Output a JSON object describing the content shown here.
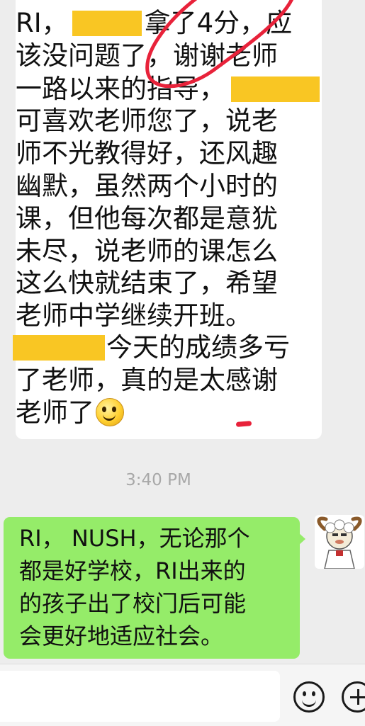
{
  "incoming_message": {
    "lines": [
      {
        "segments": [
          {
            "type": "text",
            "text": "RI，"
          },
          {
            "type": "redacted"
          },
          {
            "type": "text",
            "text": "拿了4分，应"
          }
        ]
      },
      {
        "segments": [
          {
            "type": "text",
            "text": "该没问题了，谢谢老师"
          }
        ]
      },
      {
        "segments": [
          {
            "type": "text",
            "text": "一路以来的指导，"
          },
          {
            "type": "redacted"
          }
        ]
      },
      {
        "segments": [
          {
            "type": "text",
            "text": "可喜欢老师您了，说老"
          }
        ]
      },
      {
        "segments": [
          {
            "type": "text",
            "text": "师不光教得好，还风趣"
          }
        ]
      },
      {
        "segments": [
          {
            "type": "text",
            "text": "幽默，虽然两个小时的"
          }
        ]
      },
      {
        "segments": [
          {
            "type": "text",
            "text": "课，但他每次都是意犹"
          }
        ]
      },
      {
        "segments": [
          {
            "type": "text",
            "text": "未尽，说老师的课怎么"
          }
        ]
      },
      {
        "segments": [
          {
            "type": "text",
            "text": "这么快就结束了，希望"
          }
        ]
      },
      {
        "segments": [
          {
            "type": "text",
            "text": "老师中学继续开班。"
          }
        ]
      },
      {
        "segments": [
          {
            "type": "redacted"
          },
          {
            "type": "text",
            "text": "今天的成绩多亏"
          }
        ]
      },
      {
        "segments": [
          {
            "type": "text",
            "text": "了老师，真的是太感谢"
          }
        ]
      },
      {
        "segments": [
          {
            "type": "text",
            "text": "老师了"
          },
          {
            "type": "emoji",
            "icon": "smiley-emoji-icon"
          }
        ]
      }
    ],
    "redaction_color": "#f9c623",
    "annotation_color": "#e8223a"
  },
  "timestamp": "3:40 PM",
  "outgoing_message": {
    "lines": [
      "RI， NUSH，无论那个",
      "都是好学校，RI出来的",
      "的孩子出了校门后可能",
      "会更好地适应社会。"
    ],
    "bubble_color": "#95ec69"
  },
  "avatar": {
    "icon": "sheep-cartoon-avatar-icon"
  },
  "input_bar": {
    "emoji_icon": "emoji-face-icon",
    "plus_icon": "plus-circle-icon"
  }
}
